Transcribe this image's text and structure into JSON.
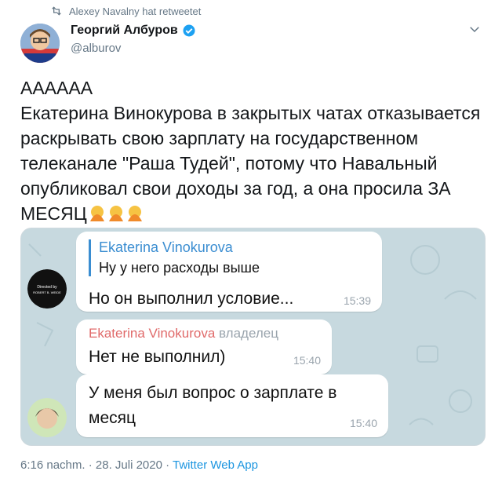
{
  "retweet": {
    "text": "Alexey Navalny hat retweetet"
  },
  "author": {
    "name": "Георгий Албуров",
    "handle": "@alburov"
  },
  "tweet": {
    "text": "АААААА\nЕкатерина Винокурова в закрытых чатах отказывается раскрывать свою зарплату на государственном телеканале \"Раша Тудей\", потому что Навальный опубликовал свои доходы за год, а она просила ЗА МЕСЯЦ",
    "emoji": [
      "facepalm-emoji",
      "facepalm-emoji",
      "facepalm-emoji"
    ]
  },
  "chat": {
    "messages": [
      {
        "quote_name": "Ekaterina Vinokurova",
        "quote_text": "Ну у него расходы выше",
        "text": "Но он выполнил условие...",
        "time": "15:39",
        "avatar_text": "Directed by ROBERT B. WEIDE"
      },
      {
        "sender_name": "Ekaterina Vinokurova",
        "sender_role": "владелец",
        "text": "Нет не выполнил)",
        "time": "15:40"
      },
      {
        "text": "У меня был вопрос о зарплате в месяц",
        "time": "15:40"
      }
    ]
  },
  "footer": {
    "datetime": "6:16 nachm. · 28. Juli 2020 · ",
    "app": "Twitter Web App"
  },
  "colors": {
    "accent": "#1b95e0",
    "quote": "#3a8dd1",
    "sender": "#e06a6a",
    "chat_bg": "#c7d9df"
  }
}
